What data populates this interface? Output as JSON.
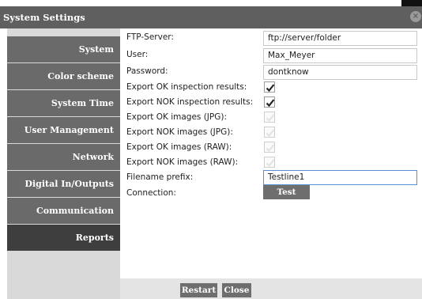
{
  "window": {
    "title": "System Settings"
  },
  "sidebar": {
    "items": [
      {
        "label": "System"
      },
      {
        "label": "Color scheme"
      },
      {
        "label": "System Time"
      },
      {
        "label": "User Management"
      },
      {
        "label": "Network"
      },
      {
        "label": "Digital In/Outputs"
      },
      {
        "label": "Communication"
      },
      {
        "label": "Reports",
        "active": true
      }
    ]
  },
  "form": {
    "ftp_server": {
      "label": "FTP-Server:",
      "value": "ftp://server/folder"
    },
    "user": {
      "label": "User:",
      "value": "Max_Meyer"
    },
    "password": {
      "label": "Password:",
      "value": "dontknow"
    },
    "export_ok_results": {
      "label": "Export OK inspection results:",
      "checked": true
    },
    "export_nok_results": {
      "label": "Export NOK inspection results:",
      "checked": true
    },
    "export_ok_jpg": {
      "label": "Export OK images (JPG):",
      "checked": false
    },
    "export_nok_jpg": {
      "label": "Export NOK images (JPG):",
      "checked": false
    },
    "export_ok_raw": {
      "label": "Export OK images (RAW):",
      "checked": false
    },
    "export_nok_raw": {
      "label": "Export NOK images (RAW):",
      "checked": false
    },
    "filename_prefix": {
      "label": "Filename prefix:",
      "value": "Testline1"
    },
    "connection": {
      "label": "Connection:",
      "button": "Test"
    }
  },
  "footer": {
    "restart_label": "Restart",
    "close_label": "Close"
  },
  "icons": {
    "close": "close-icon",
    "check": "checkmark-icon"
  },
  "colors": {
    "titlebar": "#5f5f5f",
    "sidebar_item": "#6a6a6a",
    "sidebar_active": "#3e3e3e",
    "button": "#6e6e6e",
    "focus_border": "#5a8fd0"
  }
}
